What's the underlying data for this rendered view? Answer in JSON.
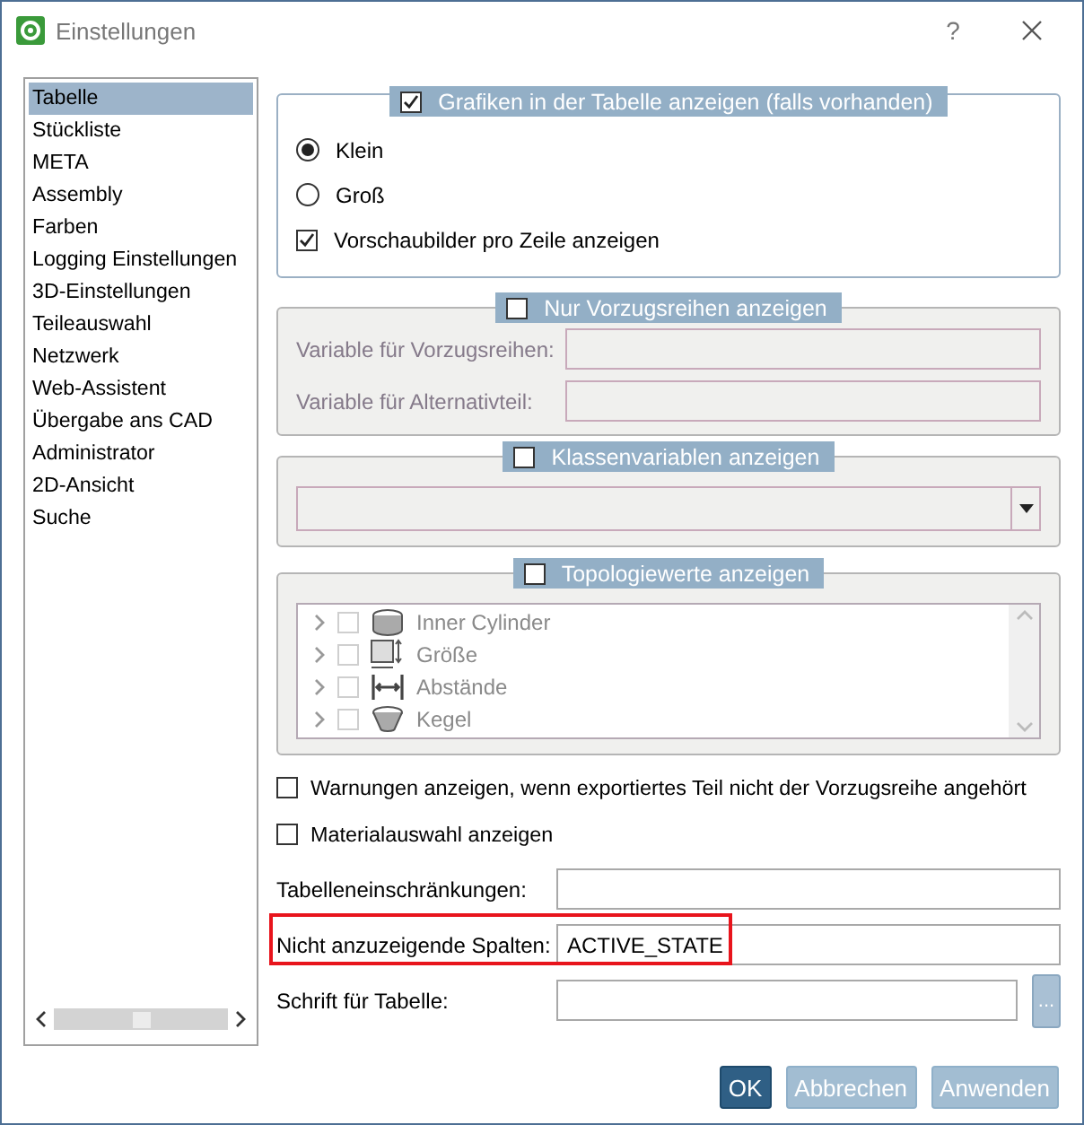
{
  "window": {
    "title": "Einstellungen",
    "help": "?"
  },
  "sidebar": {
    "items": [
      {
        "label": "Tabelle",
        "selected": true
      },
      {
        "label": "Stückliste",
        "selected": false
      },
      {
        "label": "META",
        "selected": false
      },
      {
        "label": "Assembly",
        "selected": false
      },
      {
        "label": "Farben",
        "selected": false
      },
      {
        "label": "Logging Einstellungen",
        "selected": false
      },
      {
        "label": "3D-Einstellungen",
        "selected": false
      },
      {
        "label": "Teileauswahl",
        "selected": false
      },
      {
        "label": "Netzwerk",
        "selected": false
      },
      {
        "label": "Web-Assistent",
        "selected": false
      },
      {
        "label": "Übergabe ans CAD",
        "selected": false
      },
      {
        "label": "Administrator",
        "selected": false
      },
      {
        "label": "2D-Ansicht",
        "selected": false
      },
      {
        "label": "Suche",
        "selected": false
      }
    ]
  },
  "graphics_group": {
    "label": "Grafiken in der Tabelle anzeigen (falls vorhanden)",
    "checked": true,
    "disabled": false,
    "options": [
      {
        "kind": "radio",
        "label": "Klein",
        "selected": true
      },
      {
        "kind": "radio",
        "label": "Groß",
        "selected": false
      },
      {
        "kind": "checkbox",
        "label": "Vorschaubilder pro Zeile anzeigen",
        "checked": true
      }
    ]
  },
  "preferred_group": {
    "label": "Nur Vorzugsreihen anzeigen",
    "checked": false,
    "disabled": true,
    "fields": [
      {
        "label": "Variable für Vorzugsreihen:"
      },
      {
        "label": "Variable für Alternativteil:"
      }
    ]
  },
  "class_group": {
    "label": "Klassenvariablen anzeigen",
    "checked": false,
    "disabled": true
  },
  "topology_group": {
    "label": "Topologiewerte anzeigen",
    "checked": false,
    "disabled": true,
    "items": [
      {
        "kind": "cylinder",
        "label": "Inner Cylinder",
        "checked": false
      },
      {
        "kind": "size",
        "label": "Größe",
        "checked": false
      },
      {
        "kind": "distance",
        "label": "Abstände",
        "checked": false
      },
      {
        "kind": "cone",
        "label": "Kegel",
        "checked": false
      }
    ]
  },
  "options": [
    {
      "label": "Warnungen anzeigen, wenn exportiertes Teil nicht der Vorzugsreihe angehört",
      "checked": false
    },
    {
      "label": "Materialauswahl anzeigen",
      "checked": false
    }
  ],
  "fields": [
    {
      "label": "Tabelleneinschränkungen:",
      "highlighted": false
    },
    {
      "label": "Nicht anzuzeigende Spalten:",
      "value": "ACTIVE_STATE",
      "highlighted": true
    },
    {
      "label": "Schrift für Tabelle:",
      "highlighted": false,
      "browse": "..."
    }
  ],
  "buttons": [
    {
      "label": "OK",
      "kind": "primary"
    },
    {
      "label": "Abbrechen",
      "kind": "secondary"
    },
    {
      "label": "Anwenden",
      "kind": "secondary"
    }
  ]
}
